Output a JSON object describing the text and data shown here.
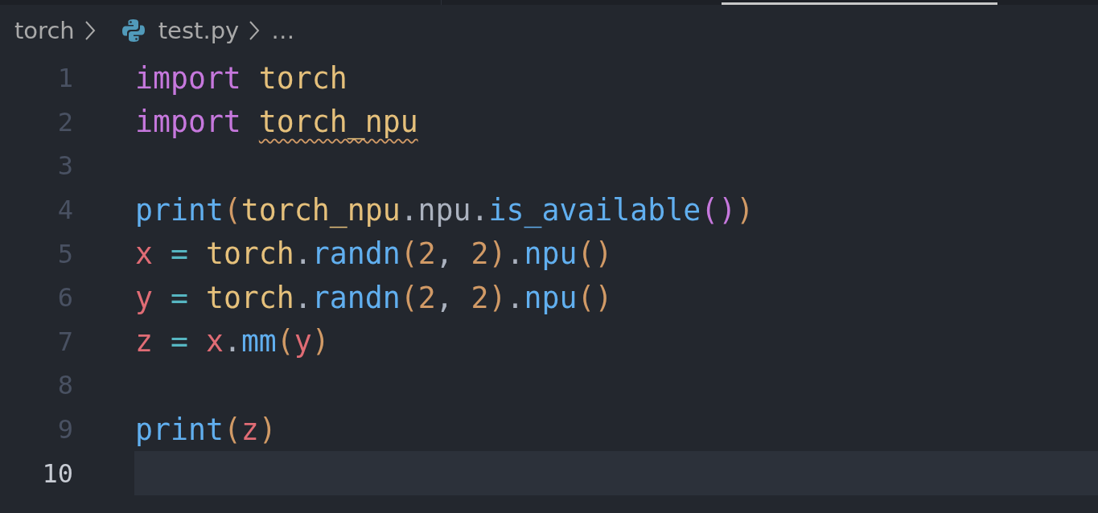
{
  "breadcrumbs": [
    {
      "label": "torch",
      "kind": "folder"
    },
    {
      "label": "test.py",
      "kind": "python-file"
    },
    {
      "label": "…",
      "kind": "more"
    }
  ],
  "editor": {
    "lines": [
      {
        "number": "1",
        "selected": false,
        "tokens": [
          {
            "text": "import ",
            "color": "#c678dd",
            "warning": false
          },
          {
            "text": "torch",
            "color": "#e5c07b",
            "warning": false
          }
        ]
      },
      {
        "number": "2",
        "selected": false,
        "tokens": [
          {
            "text": "import ",
            "color": "#c678dd",
            "warning": false
          },
          {
            "text": "torch_npu",
            "color": "#e5c07b",
            "warning": true
          }
        ]
      },
      {
        "number": "3",
        "selected": false
      },
      {
        "number": "4",
        "selected": false,
        "tokens": [
          {
            "text": "print",
            "color": "#61afef",
            "warning": false
          },
          {
            "text": "(",
            "color": "#d19a66",
            "warning": false
          },
          {
            "text": "torch_npu",
            "color": "#e5c07b",
            "warning": false
          },
          {
            "text": ".npu.",
            "color": "#abb2bf",
            "warning": false
          },
          {
            "text": "is_available",
            "color": "#61afef",
            "warning": false
          },
          {
            "text": "()",
            "color": "#c678dd",
            "warning": false
          },
          {
            "text": ")",
            "color": "#d19a66",
            "warning": false
          }
        ]
      },
      {
        "number": "5",
        "selected": false,
        "tokens": [
          {
            "text": "x",
            "color": "#e06c75",
            "warning": false
          },
          {
            "text": " = ",
            "color": "#56b6c2",
            "warning": false
          },
          {
            "text": "torch",
            "color": "#e5c07b",
            "warning": false
          },
          {
            "text": ".",
            "color": "#abb2bf",
            "warning": false
          },
          {
            "text": "randn",
            "color": "#61afef",
            "warning": false
          },
          {
            "text": "(2",
            "color": "#d19a66",
            "warning": false
          },
          {
            "text": ", ",
            "color": "#abb2bf",
            "warning": false
          },
          {
            "text": "2)",
            "color": "#d19a66",
            "warning": false
          },
          {
            "text": ".",
            "color": "#abb2bf",
            "warning": false
          },
          {
            "text": "npu",
            "color": "#61afef",
            "warning": false
          },
          {
            "text": "()",
            "color": "#d19a66",
            "warning": false
          }
        ]
      },
      {
        "number": "6",
        "selected": false,
        "tokens": [
          {
            "text": "y",
            "color": "#e06c75",
            "warning": false
          },
          {
            "text": " = ",
            "color": "#56b6c2",
            "warning": false
          },
          {
            "text": "torch",
            "color": "#e5c07b",
            "warning": false
          },
          {
            "text": ".",
            "color": "#abb2bf",
            "warning": false
          },
          {
            "text": "randn",
            "color": "#61afef",
            "warning": false
          },
          {
            "text": "(2",
            "color": "#d19a66",
            "warning": false
          },
          {
            "text": ", ",
            "color": "#abb2bf",
            "warning": false
          },
          {
            "text": "2)",
            "color": "#d19a66",
            "warning": false
          },
          {
            "text": ".",
            "color": "#abb2bf",
            "warning": false
          },
          {
            "text": "npu",
            "color": "#61afef",
            "warning": false
          },
          {
            "text": "()",
            "color": "#d19a66",
            "warning": false
          }
        ]
      },
      {
        "number": "7",
        "selected": false,
        "tokens": [
          {
            "text": "z",
            "color": "#e06c75",
            "warning": false
          },
          {
            "text": " = ",
            "color": "#56b6c2",
            "warning": false
          },
          {
            "text": "x",
            "color": "#e06c75",
            "warning": false
          },
          {
            "text": ".",
            "color": "#abb2bf",
            "warning": false
          },
          {
            "text": "mm",
            "color": "#61afef",
            "warning": false
          },
          {
            "text": "(",
            "color": "#d19a66",
            "warning": false
          },
          {
            "text": "y",
            "color": "#e06c75",
            "warning": false
          },
          {
            "text": ")",
            "color": "#d19a66",
            "warning": false
          }
        ]
      },
      {
        "number": "8",
        "selected": false
      },
      {
        "number": "9",
        "selected": false,
        "tokens": [
          {
            "text": "print",
            "color": "#61afef",
            "warning": false
          },
          {
            "text": "(",
            "color": "#d19a66",
            "warning": false
          },
          {
            "text": "z",
            "color": "#e06c75",
            "warning": false
          },
          {
            "text": ")",
            "color": "#d19a66",
            "warning": false
          }
        ]
      },
      {
        "number": "10",
        "selected": true
      }
    ]
  }
}
